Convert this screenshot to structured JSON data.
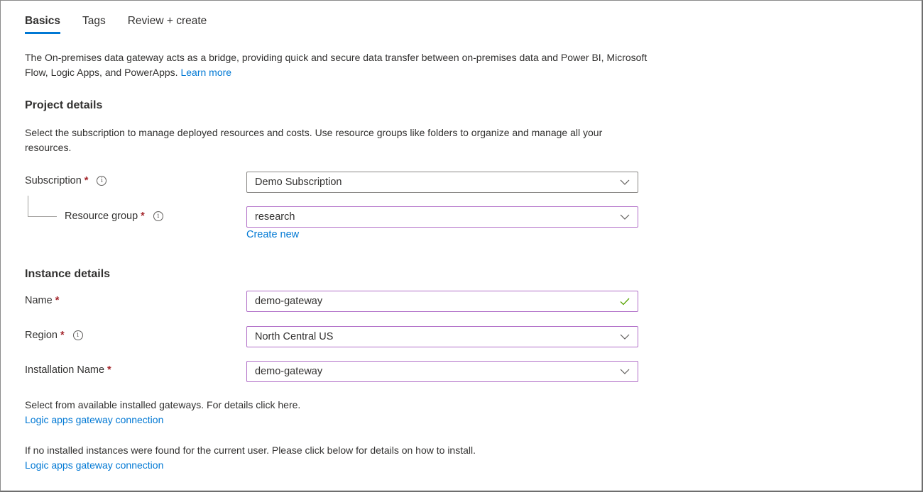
{
  "tabs": [
    {
      "label": "Basics",
      "active": true
    },
    {
      "label": "Tags",
      "active": false
    },
    {
      "label": "Review + create",
      "active": false
    }
  ],
  "intro": {
    "text": "The On-premises data gateway acts as a bridge, providing quick and secure data transfer between on-premises data and Power BI, Microsoft Flow, Logic Apps, and PowerApps.",
    "link": "Learn more"
  },
  "project_details": {
    "title": "Project details",
    "description": "Select the subscription to manage deployed resources and costs. Use resource groups like folders to organize and manage all your resources.",
    "subscription": {
      "label": "Subscription",
      "required": "*",
      "value": "Demo Subscription"
    },
    "resource_group": {
      "label": "Resource group",
      "required": "*",
      "value": "research",
      "create_new": "Create new"
    }
  },
  "instance_details": {
    "title": "Instance details",
    "name": {
      "label": "Name",
      "required": "*",
      "value": "demo-gateway",
      "valid": true
    },
    "region": {
      "label": "Region",
      "required": "*",
      "value": "North Central US"
    },
    "installation_name": {
      "label": "Installation Name",
      "required": "*",
      "value": "demo-gateway"
    }
  },
  "gateway_help": {
    "select_text": "Select from available installed gateways. For details click here.",
    "select_link": "Logic apps gateway connection",
    "install_text": "If no installed instances were found for the current user. Please click below for details on how to install.",
    "install_link": "Logic apps gateway connection"
  },
  "icons": {
    "info": "i",
    "dropdown": "chevron-down-icon",
    "valid": "checkmark-icon"
  },
  "colors": {
    "accent": "#0078d4",
    "required": "#a4262c",
    "focus_border": "#b16fc8",
    "valid_check": "#57a300"
  }
}
